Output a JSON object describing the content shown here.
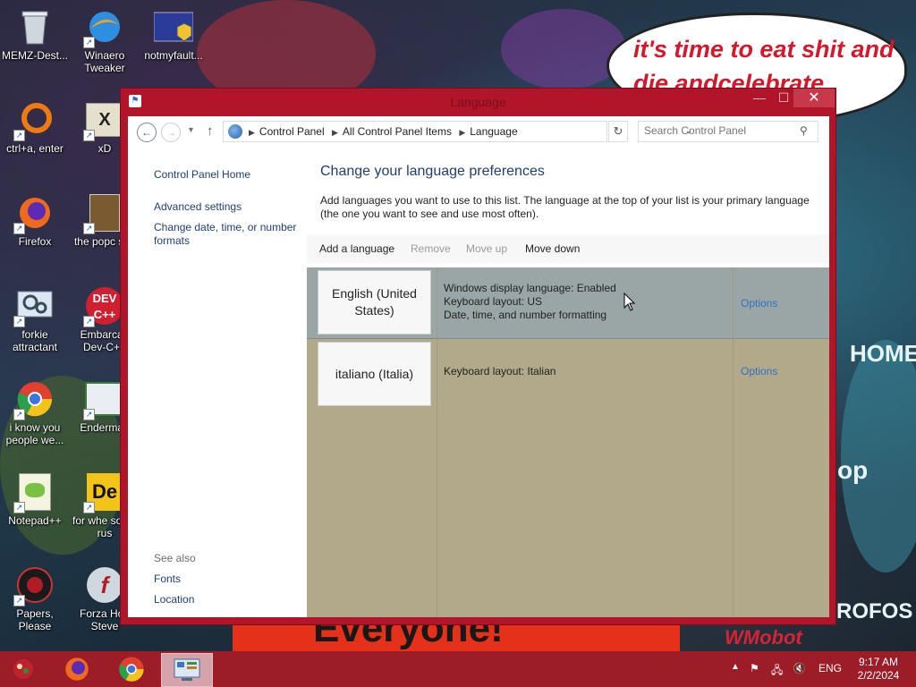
{
  "wallpaper": {
    "speech_text": "it's time to eat shit and die andcelebrate",
    "banner_text": "Everyone!",
    "side_text_1": "HOME",
    "side_text_2": "op",
    "side_text_3": "ROFOS",
    "sign_text": "WMobot"
  },
  "desktop_icons": [
    {
      "label": "MEMZ-Dest..."
    },
    {
      "label": "Winaero Tweaker"
    },
    {
      "label": "notmyfault..."
    },
    {
      "label": "ctrl+a, enter"
    },
    {
      "label": "xD"
    },
    {
      "label": "Firefox"
    },
    {
      "label": "the popc shit"
    },
    {
      "label": "forkie attractant"
    },
    {
      "label": "Embarcad Dev-C++"
    },
    {
      "label": "i know you people we..."
    },
    {
      "label": "Enderman"
    },
    {
      "label": "Notepad++"
    },
    {
      "label": "for whe some rus"
    },
    {
      "label": "Papers, Please"
    },
    {
      "label": "Forza Hori Steve"
    }
  ],
  "window": {
    "title": "Language",
    "minimize_glyph": "—",
    "maximize_glyph": "☐",
    "close_glyph": "✕"
  },
  "nav": {
    "breadcrumbs": [
      "Control Panel",
      "All Control Panel Items",
      "Language"
    ],
    "search_placeholder": "Search Control Panel"
  },
  "left_pane": {
    "home": "Control Panel Home",
    "advanced": "Advanced settings",
    "change_formats": "Change date, time, or number formats",
    "see_also": "See also",
    "fonts": "Fonts",
    "location": "Location"
  },
  "main": {
    "title": "Change your language preferences",
    "description": "Add languages you want to use to this list. The language at the top of your list is your primary language (the one you want to see and use most often).",
    "toolbar": {
      "add": "Add a language",
      "remove": "Remove",
      "move_up": "Move up",
      "move_down": "Move down"
    },
    "languages": [
      {
        "name": "English (United States)",
        "details": [
          "Windows display language: Enabled",
          "Keyboard layout: US",
          "Date, time, and number formatting"
        ],
        "options": "Options",
        "selected": true
      },
      {
        "name": "italiano (Italia)",
        "details": [
          "Keyboard layout: Italian"
        ],
        "options": "Options",
        "selected": false
      }
    ]
  },
  "taskbar": {
    "language": "ENG",
    "time": "9:17 AM",
    "date": "2/2/2024"
  },
  "colors": {
    "window_frame": "#b0152a",
    "taskbar": "#9c1d28",
    "link": "#1e3f6e",
    "options_link": "#2f72c7",
    "list_bg": "#b1a98a",
    "selected_row": "#9aa6a6"
  }
}
